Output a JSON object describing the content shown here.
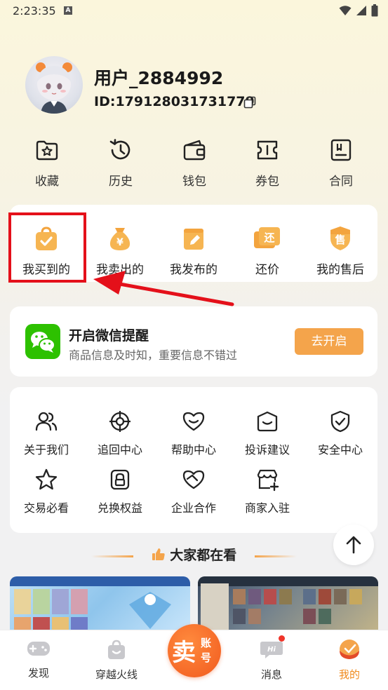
{
  "status_bar": {
    "time": "2:23:35",
    "a_badge": "A"
  },
  "profile": {
    "username": "用户_2884992",
    "user_id": "ID:179128031731779"
  },
  "quick_actions": [
    {
      "label": "收藏",
      "icon": "star-folder-icon"
    },
    {
      "label": "历史",
      "icon": "history-icon"
    },
    {
      "label": "钱包",
      "icon": "wallet-icon"
    },
    {
      "label": "券包",
      "icon": "coupon-icon"
    },
    {
      "label": "合同",
      "icon": "contract-icon"
    }
  ],
  "orders": [
    {
      "label": "我买到的",
      "icon": "shopping-bag-icon",
      "glyph": "✓"
    },
    {
      "label": "我卖出的",
      "icon": "money-bag-icon",
      "glyph": "¥"
    },
    {
      "label": "我发布的",
      "icon": "publish-icon",
      "glyph": "✎"
    },
    {
      "label": "还价",
      "icon": "bargain-icon",
      "glyph": "还"
    },
    {
      "label": "我的售后",
      "icon": "after-sale-icon",
      "glyph": "售"
    }
  ],
  "wechat": {
    "title": "开启微信提醒",
    "desc": "商品信息及时知，重要信息不错过",
    "button": "去开启"
  },
  "services": [
    {
      "label": "关于我们",
      "icon": "users-icon"
    },
    {
      "label": "追回中心",
      "icon": "target-icon"
    },
    {
      "label": "帮助中心",
      "icon": "help-heart-icon"
    },
    {
      "label": "投诉建议",
      "icon": "complaint-icon"
    },
    {
      "label": "安全中心",
      "icon": "shield-icon"
    },
    {
      "label": "交易必看",
      "icon": "star-icon"
    },
    {
      "label": "兑换权益",
      "icon": "lock-icon"
    },
    {
      "label": "企业合作",
      "icon": "handshake-icon"
    },
    {
      "label": "商家入驻",
      "icon": "store-icon"
    }
  ],
  "section": {
    "title": "大家都在看"
  },
  "bottom_nav": [
    {
      "label": "发现",
      "icon": "gamepad-icon"
    },
    {
      "label": "穿越火线",
      "icon": "bag-icon"
    },
    {
      "label": "消息",
      "icon": "message-icon",
      "badge_dot": true
    },
    {
      "label": "我的",
      "icon": "profile-icon",
      "active": true
    }
  ],
  "center_button": {
    "big": "卖",
    "small1": "账",
    "small2": "号"
  },
  "colors": {
    "accent": "#f4a44b",
    "highlight": "#e4101a",
    "wechat": "#2dc100",
    "active": "#f08a1c"
  }
}
